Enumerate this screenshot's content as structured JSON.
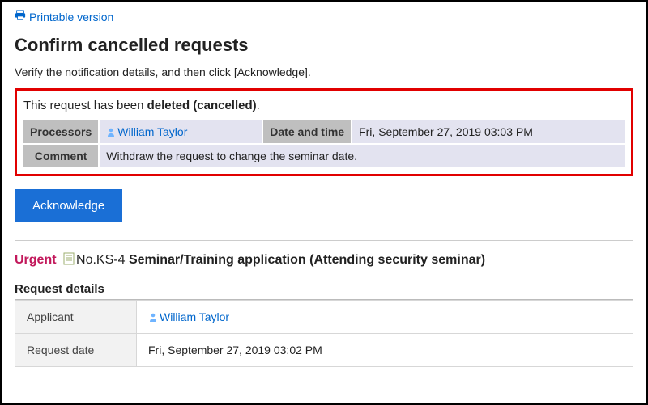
{
  "header": {
    "printable_label": "Printable version"
  },
  "page": {
    "title": "Confirm cancelled requests",
    "instructions": "Verify the notification details, and then click [Acknowledge]."
  },
  "status": {
    "prefix": "This request has been ",
    "status_text": "deleted (cancelled)",
    "suffix": "."
  },
  "info": {
    "processors_label": "Processors",
    "processor_name": "William Taylor",
    "datetime_label": "Date and time",
    "datetime_value": "Fri, September 27, 2019 03:03 PM",
    "comment_label": "Comment",
    "comment_value": "Withdraw the request to change the seminar date."
  },
  "actions": {
    "acknowledge_label": "Acknowledge"
  },
  "request": {
    "urgent_label": "Urgent",
    "number_prefix": "No.",
    "number": "KS-4",
    "title": "Seminar/Training application (Attending security seminar)"
  },
  "details": {
    "section_title": "Request details",
    "applicant_label": "Applicant",
    "applicant_name": "William Taylor",
    "request_date_label": "Request date",
    "request_date_value": "Fri, September 27, 2019 03:02 PM"
  }
}
